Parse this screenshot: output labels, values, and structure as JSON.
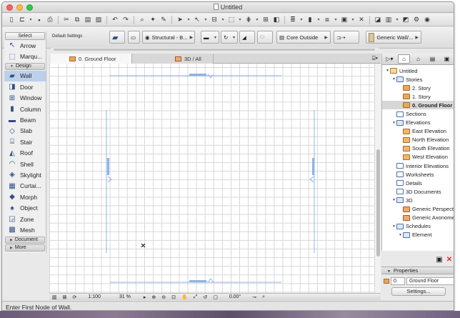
{
  "window": {
    "title": "Untitled"
  },
  "toolbar_top": {
    "icons": [
      "new-document-icon",
      "open-folder-icon",
      "save-icon",
      "print-icon",
      "cut-icon",
      "copy-icon",
      "paste-icon",
      "delete-icon",
      "undo-icon",
      "redo-icon",
      "find-select-icon",
      "magic-wand-icon",
      "eyedropper-icon",
      "pointer-icon",
      "arrow-icon",
      "trace-icon",
      "selection-icon",
      "grid-snap-icon",
      "guide-line-icon",
      "magnet-icon",
      "layers-icon",
      "pen-set-icon",
      "group-icon",
      "layer-combo-icon",
      "close-x-icon",
      "display-icon",
      "library-icon",
      "3d-view-icon",
      "settings-icon",
      "render-icon"
    ]
  },
  "info_box": {
    "default_settings_label": "Default Settings",
    "composite_label": "Structural - B...",
    "reference_line_label": "Core Outside",
    "surface_label": "Generic Wall/..."
  },
  "toolbox": {
    "select_label": "Select",
    "select_tools": [
      {
        "label": "Arrow",
        "icon": "arrow-icon"
      },
      {
        "label": "Marqu...",
        "icon": "marquee-icon"
      }
    ],
    "design_label": "Design",
    "design_tools": [
      {
        "label": "Wall",
        "icon": "wall-icon",
        "active": true
      },
      {
        "label": "Door",
        "icon": "door-icon"
      },
      {
        "label": "Window",
        "icon": "window-icon"
      },
      {
        "label": "Column",
        "icon": "column-icon"
      },
      {
        "label": "Beam",
        "icon": "beam-icon"
      },
      {
        "label": "Slab",
        "icon": "slab-icon"
      },
      {
        "label": "Stair",
        "icon": "stair-icon"
      },
      {
        "label": "Roof",
        "icon": "roof-icon"
      },
      {
        "label": "Shell",
        "icon": "shell-icon"
      },
      {
        "label": "Skylight",
        "icon": "skylight-icon"
      },
      {
        "label": "Curtai...",
        "icon": "curtain-wall-icon"
      },
      {
        "label": "Morph",
        "icon": "morph-icon"
      },
      {
        "label": "Object",
        "icon": "object-icon"
      },
      {
        "label": "Zone",
        "icon": "zone-icon"
      },
      {
        "label": "Mesh",
        "icon": "mesh-icon"
      }
    ],
    "document_label": "Document",
    "more_label": "More"
  },
  "tabs": [
    {
      "label": "0. Ground Floor",
      "active": true
    },
    {
      "label": "3D / All",
      "active": false
    }
  ],
  "status_nav": {
    "scale": "1:100",
    "zoom": "31 %",
    "angle": "0.00°"
  },
  "status_bar": {
    "message": "Enter First Node of Wall."
  },
  "navigator": {
    "tree": [
      {
        "label": "Untitled",
        "indent": 0,
        "icon": "ni-house",
        "twist": "▼"
      },
      {
        "label": "Stories",
        "indent": 1,
        "icon": "ni-doc",
        "twist": "▼"
      },
      {
        "label": "2. Story",
        "indent": 2,
        "icon": "ni-story",
        "twist": ""
      },
      {
        "label": "1. Story",
        "indent": 2,
        "icon": "ni-story",
        "twist": ""
      },
      {
        "label": "0. Ground Floor",
        "indent": 2,
        "icon": "ni-story",
        "twist": "",
        "selected": true
      },
      {
        "label": "Sections",
        "indent": 1,
        "icon": "ni-sec",
        "twist": ""
      },
      {
        "label": "Elevations",
        "indent": 1,
        "icon": "ni-doc",
        "twist": "▼"
      },
      {
        "label": "East Elevation",
        "indent": 2,
        "icon": "ni-elev",
        "twist": ""
      },
      {
        "label": "North Elevation",
        "indent": 2,
        "icon": "ni-elev",
        "twist": ""
      },
      {
        "label": "South Elevation",
        "indent": 2,
        "icon": "ni-elev",
        "twist": ""
      },
      {
        "label": "West Elevation",
        "indent": 2,
        "icon": "ni-elev",
        "twist": ""
      },
      {
        "label": "Interior Elevations",
        "indent": 1,
        "icon": "ni-sec",
        "twist": ""
      },
      {
        "label": "Worksheets",
        "indent": 1,
        "icon": "ni-sec",
        "twist": ""
      },
      {
        "label": "Details",
        "indent": 1,
        "icon": "ni-sec",
        "twist": ""
      },
      {
        "label": "3D Documents",
        "indent": 1,
        "icon": "ni-sec",
        "twist": ""
      },
      {
        "label": "3D",
        "indent": 1,
        "icon": "ni-doc",
        "twist": "▼"
      },
      {
        "label": "Generic Perspective",
        "indent": 2,
        "icon": "ni-3d",
        "twist": ""
      },
      {
        "label": "Generic Axonometry",
        "indent": 2,
        "icon": "ni-3d",
        "twist": ""
      },
      {
        "label": "Schedules",
        "indent": 1,
        "icon": "ni-doc",
        "twist": "▼"
      },
      {
        "label": "Element",
        "indent": 2,
        "icon": "ni-doc",
        "twist": "▼"
      }
    ]
  },
  "properties": {
    "header": "Properties",
    "id_value": "0.",
    "name_value": "Ground Floor",
    "settings_button": "Settings..."
  },
  "colors": {
    "accent": "#bcd0ea",
    "drawing_line": "#8fb4e6",
    "canvas_grid": "#d6d6d6"
  }
}
